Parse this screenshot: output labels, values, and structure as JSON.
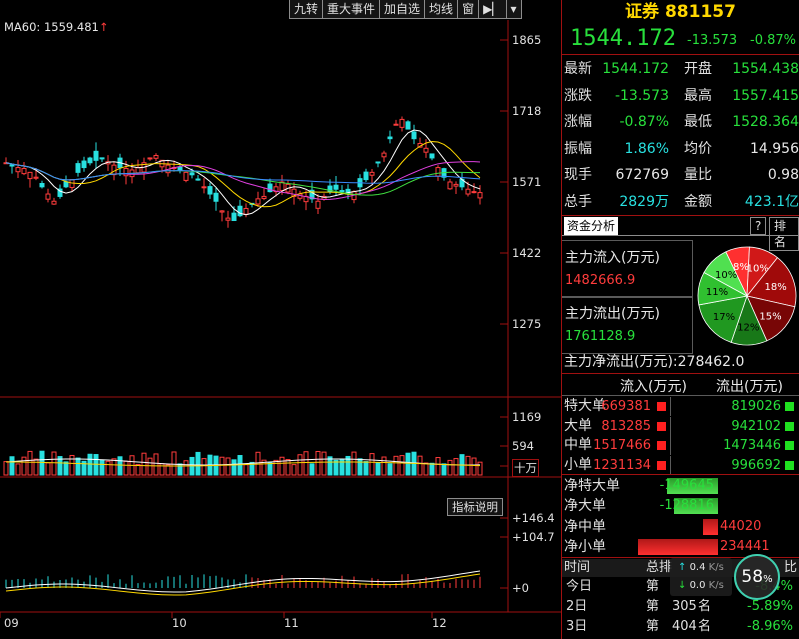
{
  "toolbar": {
    "items": [
      "九转",
      "重大事件",
      "加自选",
      "均线",
      "窗"
    ],
    "arrow_icon": "arrow-right-icon",
    "dropdown_icon": "chevron-down-icon"
  },
  "main_chart": {
    "ma_label": "MA60: 1559.481",
    "y_ticks": [
      "1865",
      "1718",
      "1571",
      "1422",
      "1275"
    ],
    "volume_ticks": [
      "1169",
      "594",
      "十万"
    ],
    "indicator_ticks": [
      "+146.4",
      "+104.7",
      "+0"
    ],
    "indicator_button": "指标说明",
    "x_ticks": [
      "09",
      "10",
      "11",
      "12"
    ]
  },
  "chart_data": {
    "type": "candlestick",
    "title": "",
    "ylim": [
      1275,
      1865
    ],
    "x_ticks": [
      "09",
      "10",
      "11",
      "12"
    ],
    "ma60": 1559.481,
    "volume_ylim": [
      0,
      1169
    ],
    "indicator_ylim": [
      0,
      146.4
    ]
  },
  "side": {
    "title": "证券 881157",
    "price": "1544.172",
    "change": "-13.573",
    "change_pct": "-0.87%",
    "quote_rows": [
      {
        "k": "最新",
        "v": "1544.172",
        "vc": "green",
        "k2": "开盘",
        "v2": "1554.438",
        "v2c": "green"
      },
      {
        "k": "涨跌",
        "v": "-13.573",
        "vc": "green",
        "k2": "最高",
        "v2": "1557.415",
        "v2c": "green"
      },
      {
        "k": "涨幅",
        "v": "-0.87%",
        "vc": "green",
        "k2": "最低",
        "v2": "1528.364",
        "v2c": "green"
      },
      {
        "k": "振幅",
        "v": "1.86%",
        "vc": "cyan",
        "k2": "均价",
        "v2": "14.956",
        "v2c": "white"
      },
      {
        "k": "现手",
        "v": "672769",
        "vc": "white",
        "k2": "量比",
        "v2": "0.98",
        "v2c": "white"
      },
      {
        "k": "总手",
        "v": "2829万",
        "vc": "cyan",
        "k2": "金额",
        "v2": "423.1亿",
        "v2c": "cyan"
      }
    ],
    "fund_tab": "资金分析",
    "help_btn": "?",
    "rank_btn": "排名",
    "inflow_label": "主力流入(万元)",
    "inflow_value": "1482666.9",
    "outflow_label": "主力流出(万元)",
    "outflow_value": "1761128.9",
    "pie_labels": [
      "8%",
      "10%",
      "18%",
      "15%",
      "12%",
      "17%",
      "11%",
      "10%"
    ],
    "net_label": "主力净流出(万元):278462.0",
    "flow_header_in": "流入(万元)",
    "flow_header_out": "流出(万元)",
    "flow_rows": [
      {
        "k": "特大单",
        "in": "669381",
        "out": "819026"
      },
      {
        "k": "大单",
        "in": "813285",
        "out": "942102"
      },
      {
        "k": "中单",
        "in": "1517466",
        "out": "1473446"
      },
      {
        "k": "小单",
        "in": "1231134",
        "out": "996692"
      }
    ],
    "net_rows": [
      {
        "k": "净特大单",
        "v": "-149645",
        "c": "green"
      },
      {
        "k": "净大单",
        "v": "-128816",
        "c": "green"
      },
      {
        "k": "净中单",
        "v": "44020",
        "c": "red"
      },
      {
        "k": "净小单",
        "v": "234441",
        "c": "red"
      }
    ],
    "rank_header": [
      "时间",
      "总排",
      "比"
    ],
    "rank_rows": [
      {
        "t": "今日",
        "r": "第",
        "n": "",
        "m": "",
        "p": "-8.4%"
      },
      {
        "t": "2日",
        "r": "第",
        "n": "305",
        "m": "名",
        "p": "-5.89%"
      },
      {
        "t": "3日",
        "r": "第",
        "n": "404",
        "m": "名",
        "p": "-8.96%"
      }
    ],
    "net_speed_up": "0.4",
    "net_speed_down": "0.0",
    "net_speed_unit": "K/s",
    "net_percent": "58",
    "net_percent_unit": "%"
  }
}
